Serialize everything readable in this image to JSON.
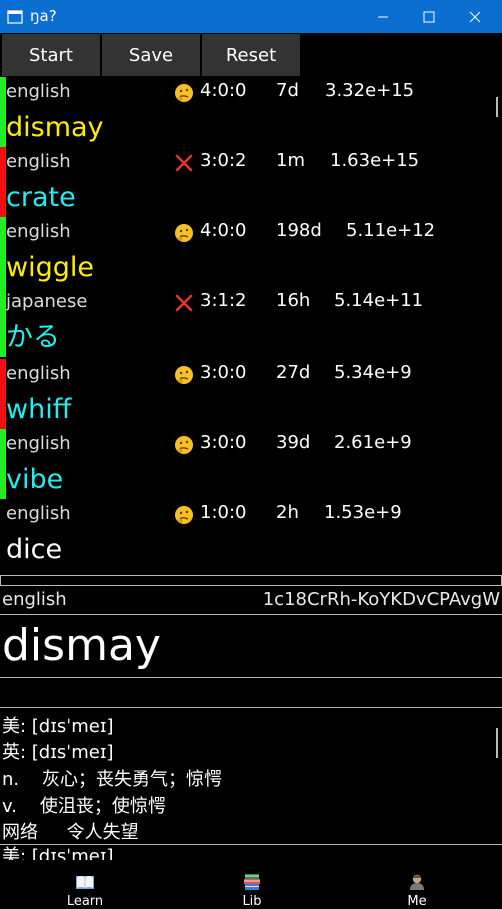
{
  "window": {
    "title": "ŋa?"
  },
  "toolbar": {
    "start_label": "Start",
    "save_label": "Save",
    "reset_label": "Reset"
  },
  "list": [
    {
      "lang": "english",
      "status": "thinking",
      "score": "4:0:0",
      "interval": "7d",
      "value": "3.32e+15",
      "word": "dismay",
      "word_color": "#ffee00",
      "bar_color": "#22ee22"
    },
    {
      "lang": "english",
      "status": "wrong",
      "score": "3:0:2",
      "interval": "1m",
      "value": "1.63e+15",
      "word": "crate",
      "word_color": "#22eeee",
      "bar_color": "#ee1111"
    },
    {
      "lang": "english",
      "status": "thinking",
      "score": "4:0:0",
      "interval": "198d",
      "value": "5.11e+12",
      "word": "wiggle",
      "word_color": "#ffee00",
      "bar_color": "#22ee22"
    },
    {
      "lang": "japanese",
      "status": "wrong",
      "score": "3:1:2",
      "interval": "16h",
      "value": "5.14e+11",
      "word": "かる",
      "word_color": "#22eeee",
      "bar_color": "#22ee22"
    },
    {
      "lang": "english",
      "status": "thinking",
      "score": "3:0:0",
      "interval": "27d",
      "value": "5.34e+9",
      "word": "whiff",
      "word_color": "#22eeee",
      "bar_color": "#ee1111"
    },
    {
      "lang": "english",
      "status": "thinking",
      "score": "3:0:0",
      "interval": "39d",
      "value": "2.61e+9",
      "word": "vibe",
      "word_color": "#22eeee",
      "bar_color": "#22ee22"
    },
    {
      "lang": "english",
      "status": "thinking",
      "score": "1:0:0",
      "interval": "2h",
      "value": "1.53e+9",
      "word": "dice",
      "word_color": "#ffffff",
      "bar_color": "#000000"
    }
  ],
  "detail": {
    "lang": "english",
    "id": "1c18CrRh-KoYKDvCPAvgW",
    "word": "dismay",
    "lines": [
      "美: [dɪsˈmeɪ]",
      "英: [dɪsˈmeɪ]",
      "n.    灰心；丧失勇气；惊愕",
      "v.    使沮丧；使惊愕",
      "网络     令人失望"
    ],
    "partial": "美: [dɪsˈmeɪ]"
  },
  "nav": {
    "learn_label": "Learn",
    "lib_label": "Lib",
    "me_label": "Me"
  }
}
